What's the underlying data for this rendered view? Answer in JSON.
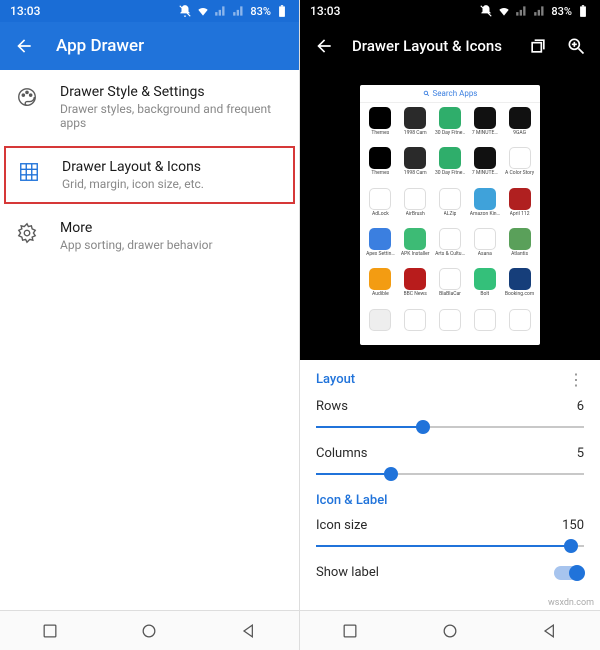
{
  "status": {
    "time": "13:03",
    "battery": "83%"
  },
  "left": {
    "header": "App Drawer",
    "items": [
      {
        "title": "Drawer Style & Settings",
        "sub": "Drawer styles, background and frequent apps"
      },
      {
        "title": "Drawer Layout & Icons",
        "sub": "Grid, margin, icon size, etc."
      },
      {
        "title": "More",
        "sub": "App sorting, drawer behavior"
      }
    ]
  },
  "right": {
    "header": "Drawer Layout & Icons",
    "search": "Search Apps",
    "apps": [
      {
        "l": "Themes",
        "c": "#000"
      },
      {
        "l": "1998 Cam",
        "c": "#2a2a2a"
      },
      {
        "l": "30 Day Fitne…",
        "c": "#2fae6b"
      },
      {
        "l": "7 MINUTE…",
        "c": "#111"
      },
      {
        "l": "9GAG",
        "c": "#111"
      },
      {
        "l": "Themes",
        "c": "#000"
      },
      {
        "l": "1998 Cam",
        "c": "#2a2a2a"
      },
      {
        "l": "30 Day Fitne…",
        "c": "#2fae6b"
      },
      {
        "l": "7 MINUTE…",
        "c": "#111"
      },
      {
        "l": "A Color Story",
        "c": "#fff"
      },
      {
        "l": "AdLock",
        "c": "#fff"
      },
      {
        "l": "AirBrush",
        "c": "#fff"
      },
      {
        "l": "ALZip",
        "c": "#fff"
      },
      {
        "l": "Amazon Kin…",
        "c": "#3fa2da"
      },
      {
        "l": "April 112",
        "c": "#b02020"
      },
      {
        "l": "Apex Settin…",
        "c": "#3b7fe0"
      },
      {
        "l": "APK Installer",
        "c": "#3dbb75"
      },
      {
        "l": "Arts & Cultu…",
        "c": "#fff"
      },
      {
        "l": "Asana",
        "c": "#fff"
      },
      {
        "l": "Atlantis",
        "c": "#5aa05a"
      },
      {
        "l": "Audible",
        "c": "#f39c12"
      },
      {
        "l": "BBC News",
        "c": "#b81c1c"
      },
      {
        "l": "BlaBlaCar",
        "c": "#fff"
      },
      {
        "l": "Bolt",
        "c": "#34c07a"
      },
      {
        "l": "Booking.com",
        "c": "#163e7a"
      },
      {
        "l": "",
        "c": "#eee"
      },
      {
        "l": "",
        "c": "#fff"
      },
      {
        "l": "",
        "c": "#fff"
      },
      {
        "l": "",
        "c": "#fff"
      },
      {
        "l": "",
        "c": "#fff"
      }
    ],
    "sections": {
      "layout": "Layout",
      "iconlabel": "Icon & Label"
    },
    "rows": {
      "label": "Rows",
      "value": "6",
      "pct": 40
    },
    "cols": {
      "label": "Columns",
      "value": "5",
      "pct": 28
    },
    "iconsize": {
      "label": "Icon size",
      "value": "150",
      "pct": 95
    },
    "showlabel": {
      "label": "Show label"
    }
  },
  "watermark": "wsxdn.com"
}
